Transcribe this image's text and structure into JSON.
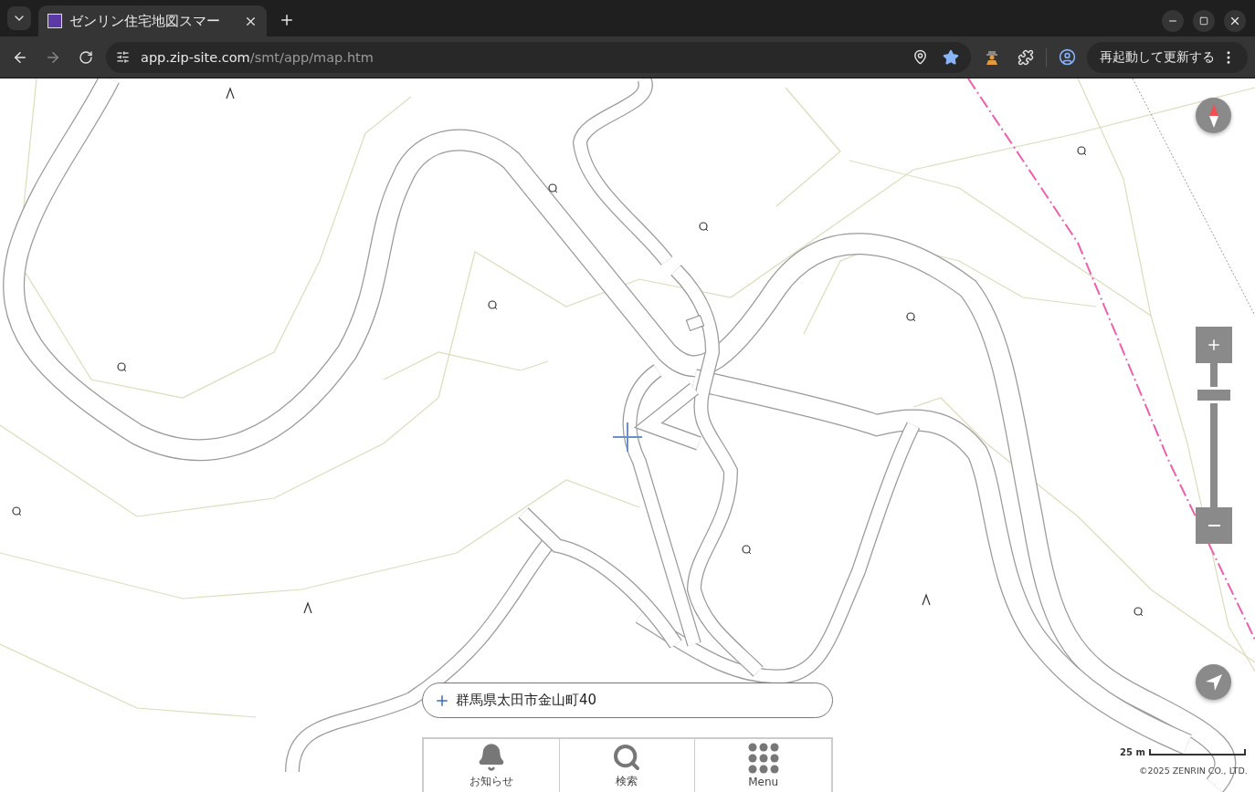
{
  "browser": {
    "tabs": [
      {
        "title": "ゼンリン住宅地図スマー",
        "selected": true
      }
    ],
    "url": {
      "host": "app.zip-site.com",
      "path": "/smt/app/map.htm"
    },
    "bookmarked": true,
    "update_button": "再起動して更新する"
  },
  "map": {
    "zoom": {
      "level": 0.78
    },
    "address": "群馬県太田市金山町40",
    "nav": [
      {
        "kind": "bell",
        "label": "お知らせ"
      },
      {
        "kind": "search",
        "label": "検索"
      },
      {
        "kind": "grid",
        "label": "Menu"
      }
    ],
    "scale": "25 m",
    "copyright": "©2025 ZENRIN CO., LTD."
  }
}
